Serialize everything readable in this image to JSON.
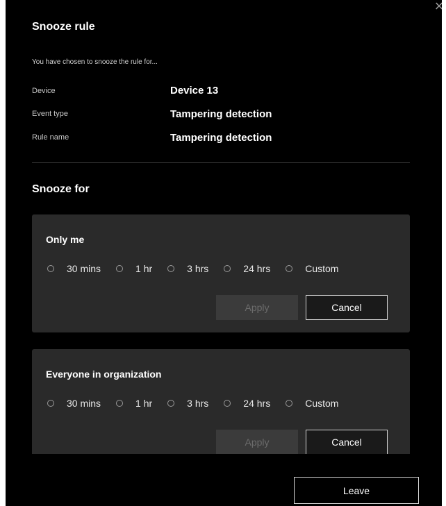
{
  "dialog": {
    "title": "Snooze rule",
    "intro": "You have chosen to snooze the rule for...",
    "close_icon": "close-icon"
  },
  "details": [
    {
      "label": "Device",
      "value": "Device 13"
    },
    {
      "label": "Event type",
      "value": "Tampering detection"
    },
    {
      "label": "Rule name",
      "value": "Tampering detection"
    }
  ],
  "snooze": {
    "section_title": "Snooze for",
    "only_me": {
      "title": "Only me",
      "options": [
        "30 mins",
        "1 hr",
        "3 hrs",
        "24 hrs",
        "Custom"
      ],
      "apply_label": "Apply",
      "cancel_label": "Cancel"
    },
    "everyone": {
      "title": "Everyone in organization",
      "options": [
        "30 mins",
        "1 hr",
        "3 hrs",
        "24 hrs",
        "Custom"
      ],
      "apply_label": "Apply",
      "cancel_label": "Cancel"
    }
  },
  "footer": {
    "leave_label": "Leave"
  },
  "colors": {
    "background": "#000000",
    "card": "#2a2a2a",
    "disabled_button": "#3b3b3b",
    "text": "#ffffff"
  }
}
